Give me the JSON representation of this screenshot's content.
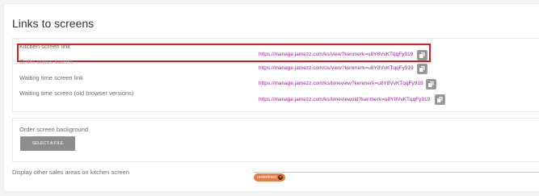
{
  "section": {
    "title": "Links to screens"
  },
  "links": [
    {
      "label": "Kitchen screen link",
      "url": "https://manage.jamezz.com/ks/view?kenmerk=u8Y8VvKTqqFy919"
    },
    {
      "label": "Order status screen",
      "url": "https://manage.jamezz.com/os/view?kenmerk=u8Y8VvKTqqFy919"
    },
    {
      "label": "Waiting time screen link",
      "url": "https://manage.jamezz.com/ks/timeview?kenmerk=u8Y8VvKTqqFy919"
    },
    {
      "label": "Waiting time screen (old browser versions)",
      "url": "https://manage.jamezz.com/ks/timeviewold?kenmerk=u8Y8VvKTqqFy919"
    }
  ],
  "background": {
    "label": "Order screen background",
    "button_label": "SELECT A FILE"
  },
  "other_sales_areas": {
    "label": "Display other sales areas on kitchen screen",
    "tag": "undefined",
    "tag_remove": "×"
  },
  "icons": {
    "copy": "copy-icon",
    "tag_remove": "close-icon"
  },
  "colors": {
    "link": "#9b1f9b",
    "highlight": "#e01b1b",
    "tag": "#ec7a3c",
    "button": "#8d8d8d"
  }
}
